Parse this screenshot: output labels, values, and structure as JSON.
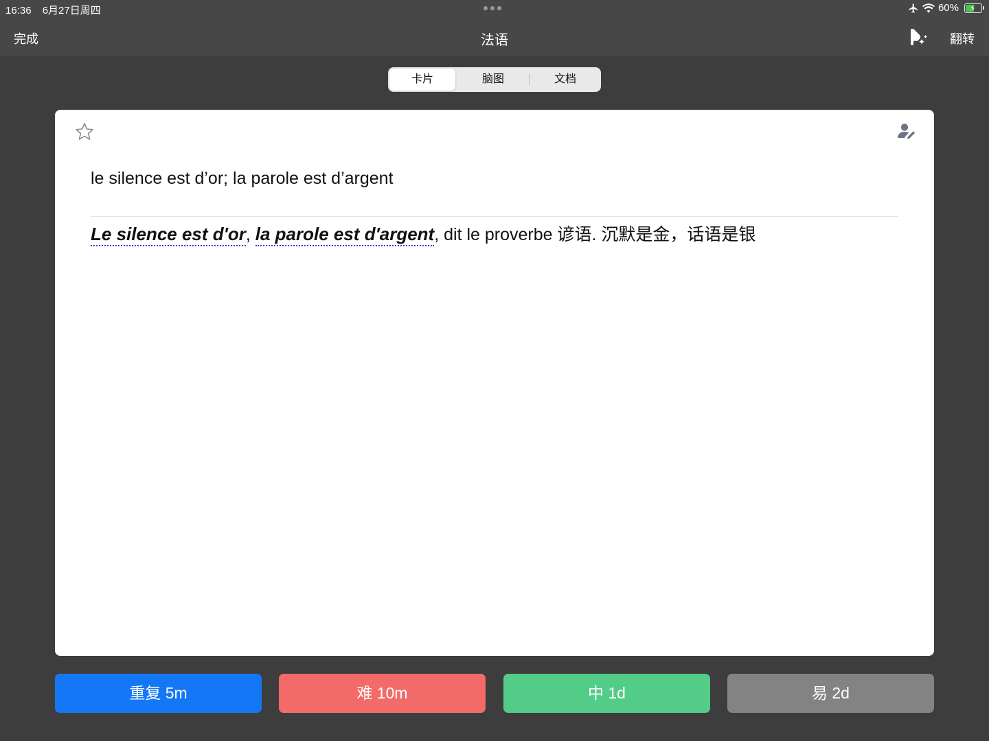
{
  "status_bar": {
    "time": "16:36",
    "date": "6月27日周四",
    "battery_percent": "60%",
    "battery_level": 0.6,
    "icons": [
      "airplane-icon",
      "wifi-icon",
      "battery-charging-icon"
    ]
  },
  "nav": {
    "done_label": "完成",
    "title": "法语",
    "voice_icon": "speaker-voice-icon",
    "flip_label": "翻转"
  },
  "tabs": [
    {
      "label": "卡片",
      "active": true
    },
    {
      "label": "脑图",
      "active": false
    },
    {
      "label": "文档",
      "active": false
    }
  ],
  "card": {
    "star_icon": "star-outline-icon",
    "edit_icon": "user-edit-icon",
    "front_text": "le silence est d’or; la parole est d’argent",
    "back": {
      "phrase_1": "Le silence est d'or",
      "separator": ", ",
      "phrase_2": "la parole est d'argent",
      "rest": ", dit le proverbe 谚语. 沉默是金，话语是银"
    }
  },
  "answer_buttons": {
    "repeat": "重复 5m",
    "hard": "难 10m",
    "medium": "中 1d",
    "easy": "易 2d"
  },
  "colors": {
    "background": "#3d3d3d",
    "bar": "#474747",
    "repeat": "#1478f6",
    "hard": "#f26b68",
    "medium": "#52cc87",
    "easy": "#838383",
    "battery": "#47c74f"
  }
}
